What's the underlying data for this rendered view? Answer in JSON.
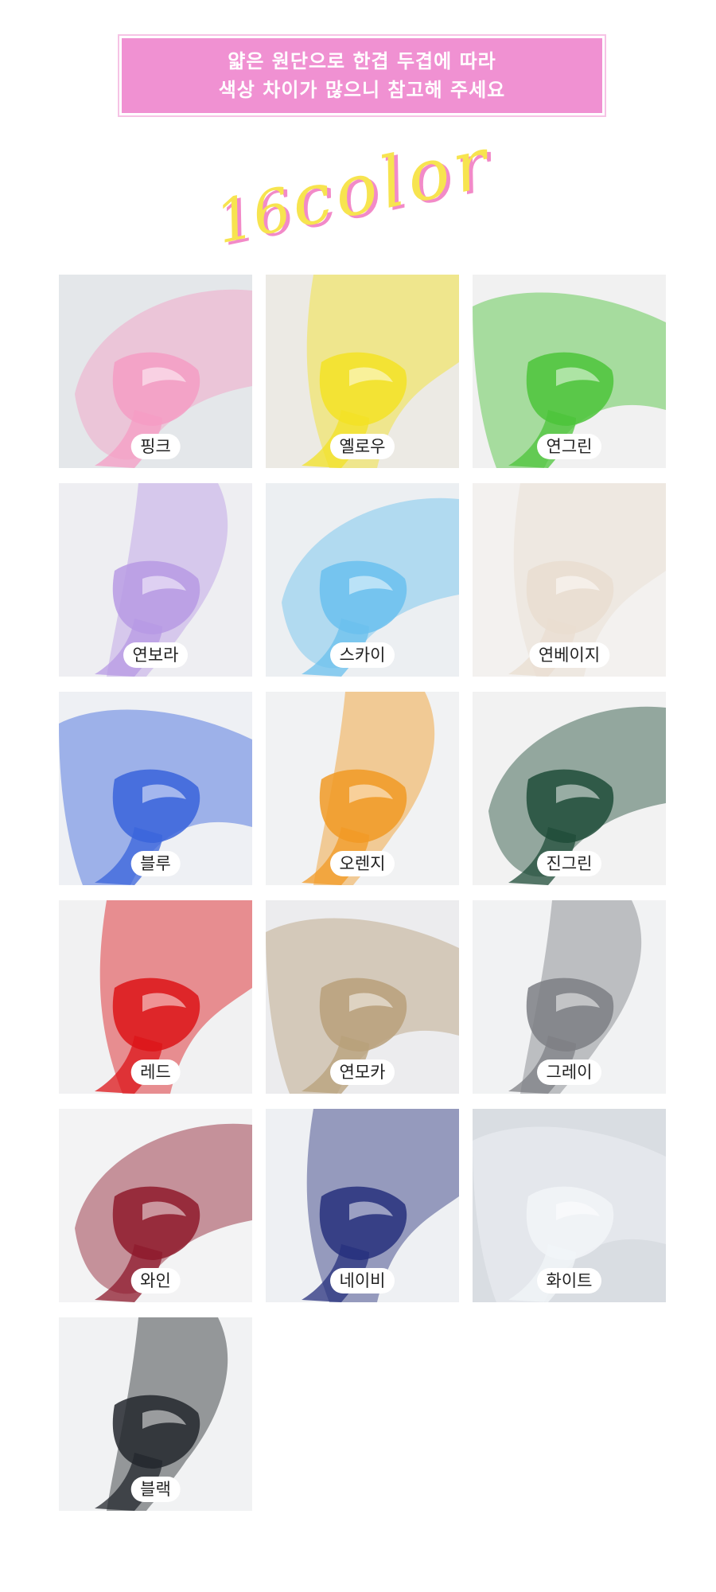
{
  "banner": {
    "line1": "얇은 원단으로 한겹 두겹에 따라",
    "line2": "색상 차이가 많으니 참고해 주세요",
    "background": "#f091d2"
  },
  "title": {
    "number": "16",
    "word": "color",
    "color": "#f7e44f",
    "shadow": "#f28ac8"
  },
  "swatches": [
    {
      "label": "핑크",
      "color": "#f59cc4",
      "bg": "#e4e7ea"
    },
    {
      "label": "옐로우",
      "color": "#f3e224",
      "bg": "#eceae4"
    },
    {
      "label": "연그린",
      "color": "#4cc43a",
      "bg": "#f1f1f1"
    },
    {
      "label": "연보라",
      "color": "#b79ae4",
      "bg": "#eeeef2"
    },
    {
      "label": "스카이",
      "color": "#6bc0ee",
      "bg": "#eceff2"
    },
    {
      "label": "연베이지",
      "color": "#e9ddd0",
      "bg": "#f3f1ef"
    },
    {
      "label": "블루",
      "color": "#3a64db",
      "bg": "#eef0f4"
    },
    {
      "label": "오렌지",
      "color": "#f19a24",
      "bg": "#f1f2f3"
    },
    {
      "label": "진그린",
      "color": "#1f4c38",
      "bg": "#f2f2f2"
    },
    {
      "label": "레드",
      "color": "#dc1418",
      "bg": "#f1f1f2"
    },
    {
      "label": "연모카",
      "color": "#b8a07a",
      "bg": "#ececee"
    },
    {
      "label": "그레이",
      "color": "#7d7f84",
      "bg": "#f1f2f3"
    },
    {
      "label": "와인",
      "color": "#8e1a2c",
      "bg": "#f3f3f4"
    },
    {
      "label": "네이비",
      "color": "#27307d",
      "bg": "#eef0f3"
    },
    {
      "label": "화이트",
      "color": "#f2f5f8",
      "bg": "#d9dde2"
    },
    {
      "label": "블랙",
      "color": "#23272d",
      "bg": "#f1f2f3"
    }
  ]
}
